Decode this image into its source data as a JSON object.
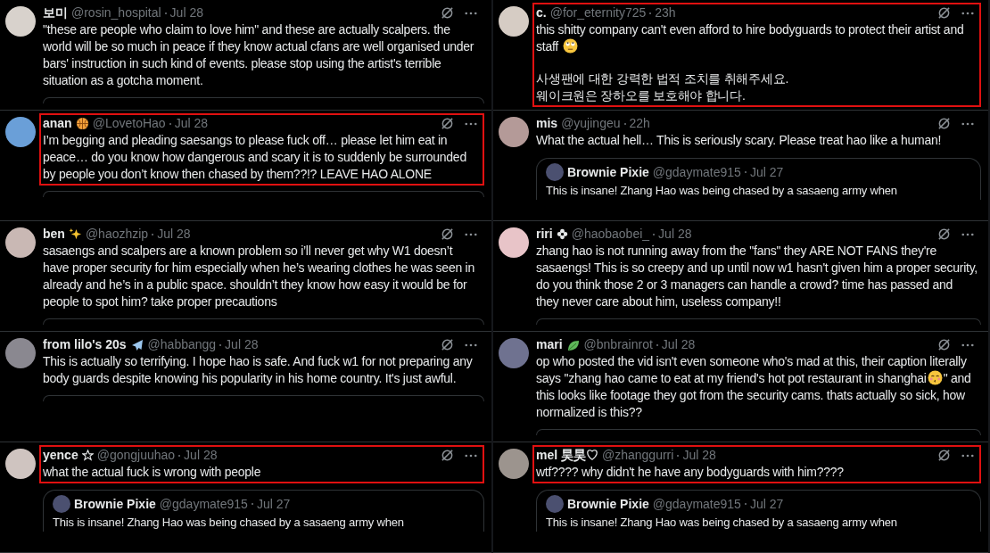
{
  "columns": [
    {
      "tweets": [
        {
          "name": "보미",
          "handle": "@rosin_hospital",
          "date": "Jul 28",
          "highlighted": false,
          "color": "#d8d2cc",
          "body": [
            [
              {
                "kind": "text",
                "text": "\"these are people who claim to love him\" and these are actually scalpers. the world will be so much in peace if they know actual cfans are well organised under bars' instruction in such kind of events. please stop using the artist's terrible situation as a gotcha moment."
              }
            ]
          ],
          "quote": {
            "kind": "stub"
          }
        },
        {
          "name": "anan",
          "badge": {
            "kind": "ball"
          },
          "handle": "@LovetoHao",
          "date": "Jul 28",
          "highlighted": true,
          "color": "#6a9fd8",
          "body": [
            [
              {
                "kind": "text",
                "text": "I’m begging and pleading saesangs to please fuck off… please let him eat in peace… do you know how dangerous and scary it is to suddenly be surrounded by people you don’t know then chased by them??!? LEAVE HAO ALONE"
              }
            ]
          ],
          "quote": {
            "kind": "stub"
          }
        },
        {
          "name": "ben",
          "badge": {
            "kind": "sparkle"
          },
          "handle": "@haozhzip",
          "date": "Jul 28",
          "highlighted": false,
          "color": "#c9b8b4",
          "body": [
            [
              {
                "kind": "text",
                "text": "sasaengs and scalpers are a known problem so i’ll never get why W1 doesn’t have proper security for him especially when he’s wearing clothes he was seen in already and he’s in a public space. shouldn’t they know how easy it would be for people to spot him? take proper precautions"
              }
            ]
          ],
          "quote": {
            "kind": "stub"
          }
        },
        {
          "name": "from lilo's 20s",
          "badge": {
            "kind": "plane"
          },
          "handle": "@habbangg",
          "date": "Jul 28",
          "highlighted": false,
          "color": "#8a8890",
          "body": [
            [
              {
                "kind": "text",
                "text": "This is actually so terrifying. I hope hao is safe. And fuck w1 for not preparing any body guards despite knowing his popularity in his home country. It's just awful."
              }
            ]
          ],
          "quote": {
            "kind": "stub"
          }
        },
        {
          "name": "yence",
          "badge": {
            "kind": "star"
          },
          "handle": "@gongjuuhao",
          "date": "Jul 28",
          "highlighted": true,
          "color": "#cfc4c0",
          "body": [
            [
              {
                "kind": "text",
                "text": "what the actual fuck is wrong with people"
              }
            ]
          ],
          "quote": {
            "kind": "card",
            "name": "Brownie Pixie",
            "handle": "@gdaymate915",
            "date": "Jul 27",
            "text": "This is insane! Zhang Hao was being chased by a sasaeng army when"
          }
        }
      ]
    },
    {
      "tweets": [
        {
          "name": "c.",
          "handle": "@for_eternity725",
          "date": "23h",
          "highlighted": true,
          "color": "#d6ccc4",
          "body": [
            [
              {
                "kind": "text",
                "text": "this shitty company can't even afford to hire bodyguards to protect their artist and staff "
              },
              {
                "kind": "eye-roll-emoji"
              }
            ],
            [
              {
                "kind": "text",
                "text": "사생팬에 대한 강력한 법적 조치를 취해주세요."
              },
              {
                "kind": "break"
              },
              {
                "kind": "text",
                "text": "웨이크원은 장하오를 보호해야 합니다."
              }
            ]
          ],
          "quote": {
            "kind": "none"
          }
        },
        {
          "name": "mis",
          "handle": "@yujingeu",
          "date": "22h",
          "highlighted": false,
          "color": "#b49a98",
          "body": [
            [
              {
                "kind": "text",
                "text": "What the actual hell… This is seriously scary. Please treat hao like a human!"
              }
            ]
          ],
          "quote": {
            "kind": "card",
            "name": "Brownie Pixie",
            "handle": "@gdaymate915",
            "date": "Jul 27",
            "text": "This is insane! Zhang Hao was being chased by a sasaeng army when"
          }
        },
        {
          "name": "riri",
          "badge": {
            "kind": "flower"
          },
          "handle": "@haobaobei_",
          "date": "Jul 28",
          "highlighted": false,
          "color": "#e8c4c8",
          "body": [
            [
              {
                "kind": "text",
                "text": "zhang hao is not running away from the \"fans\" they ARE NOT FANS they're sasaengs! This is so creepy and up until now w1 hasn't given him a proper security, do you think those 2 or 3 managers can handle a crowd? time has passed and they never care about him, useless company!!"
              }
            ]
          ],
          "quote": {
            "kind": "stub"
          }
        },
        {
          "name": "mari",
          "badge": {
            "kind": "leaf"
          },
          "handle": "@bnbrainrot",
          "date": "Jul 28",
          "highlighted": false,
          "color": "#6f7290",
          "body": [
            [
              {
                "kind": "text",
                "text": "op who posted the vid isn't even someone who's mad at this, their caption literally says \"zhang hao came to eat at my friend's hot pot restaurant in shanghai"
              },
              {
                "kind": "kiss-emoji"
              },
              {
                "kind": "text",
                "text": "\" and this looks like footage they got from the security cams. thats actually so sick, how normalized is this??"
              }
            ]
          ],
          "quote": {
            "kind": "stub"
          }
        },
        {
          "name": "mel  昊昊♡",
          "handle": "@zhanggurri",
          "date": "Jul 28",
          "highlighted": true,
          "color": "#9c948e",
          "body": [
            [
              {
                "kind": "text",
                "text": "wtf???? why didn't he have any bodyguards with him????"
              }
            ]
          ],
          "quote": {
            "kind": "card",
            "name": "Brownie Pixie",
            "handle": "@gdaymate915",
            "date": "Jul 27",
            "text": "This is insane! Zhang Hao was being chased by a sasaeng army when"
          }
        }
      ]
    }
  ]
}
